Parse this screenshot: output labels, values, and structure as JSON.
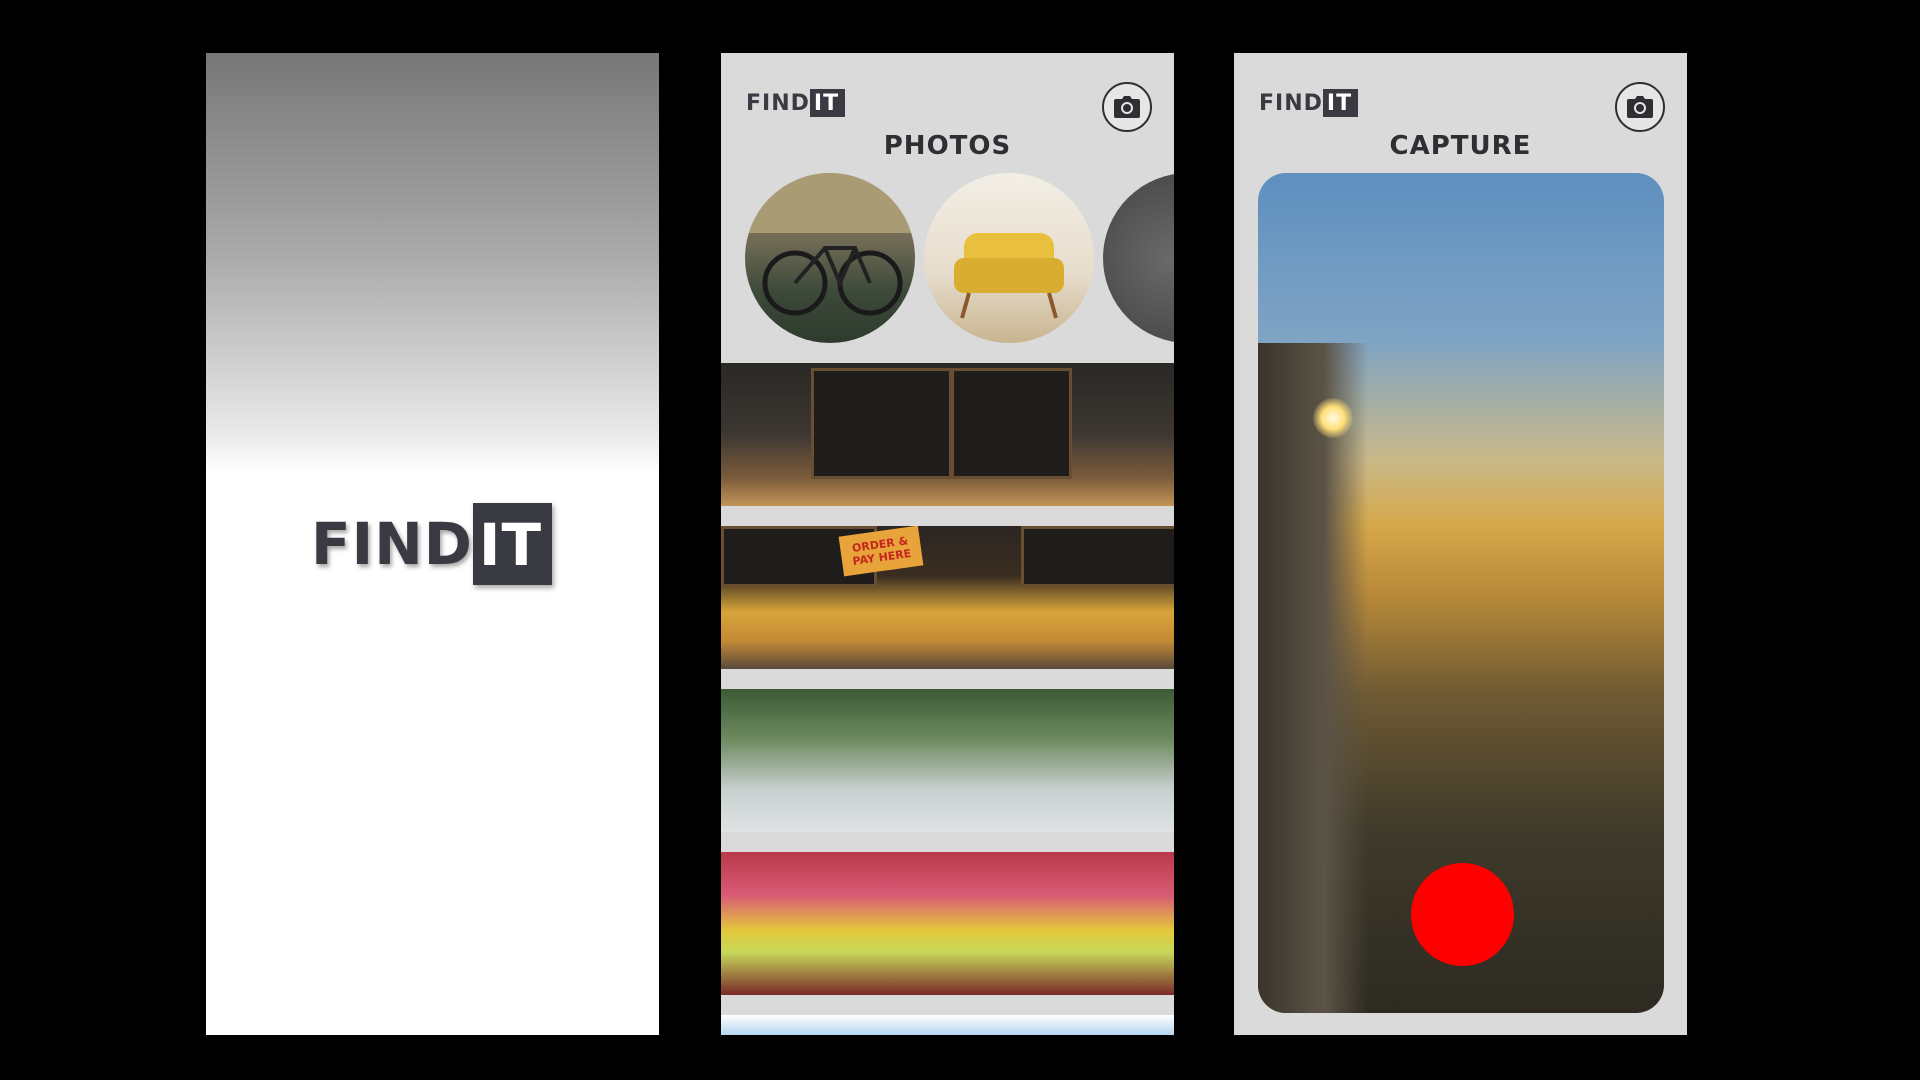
{
  "splash": {
    "logo_find": "FIND",
    "logo_it": "IT"
  },
  "photos_screen": {
    "logo_find": "FIND",
    "logo_it": "IT",
    "title": "PHOTOS",
    "camera_icon": "camera-icon",
    "circle_photos": [
      {
        "subject": "bicycle"
      },
      {
        "subject": "armchair"
      },
      {
        "subject": "dark object"
      }
    ],
    "photo_strips": [
      {
        "subject": "cafe menu board"
      },
      {
        "subject": "bakery counter",
        "sign_text": "ORDER & PAY HERE"
      },
      {
        "subject": "water fountains"
      },
      {
        "subject": "flower market"
      },
      {
        "subject": "partial image"
      }
    ]
  },
  "capture_screen": {
    "logo_find": "FIND",
    "logo_it": "IT",
    "title": "CAPTURE",
    "camera_icon": "camera-icon",
    "record_button_color": "#ff0000"
  },
  "colors": {
    "background": "#000000",
    "panel": "#dadada",
    "logo_dark": "#3a3a42",
    "record": "#ff0000"
  }
}
